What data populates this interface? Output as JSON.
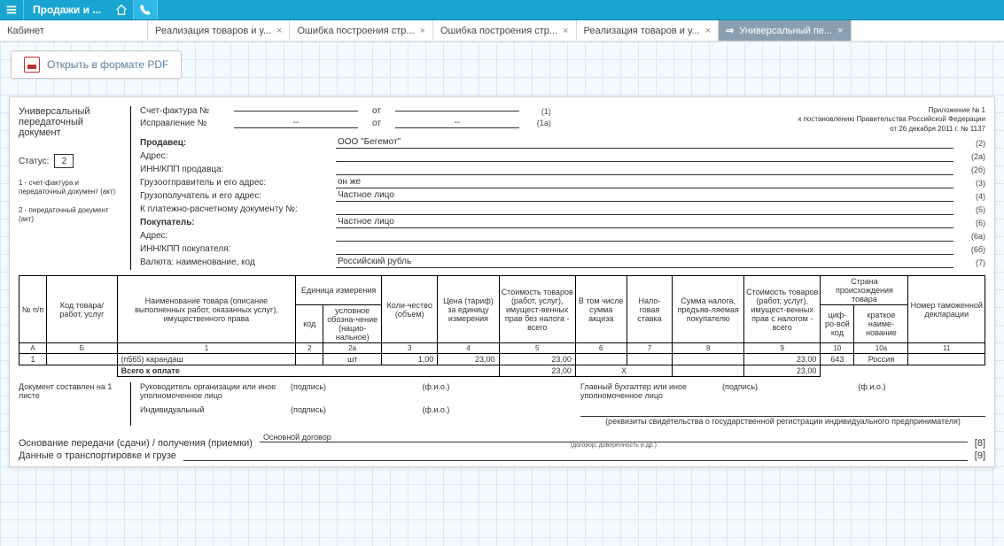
{
  "topbar": {
    "title": "Продажи и ..."
  },
  "tabs": [
    {
      "label": "Кабинет",
      "closable": false
    },
    {
      "label": "Реализация товаров и у...",
      "closable": true
    },
    {
      "label": "Ошибка построения стр...",
      "closable": true
    },
    {
      "label": "Ошибка построения стр...",
      "closable": true
    },
    {
      "label": "Реализация товаров и у...",
      "closable": true
    },
    {
      "label": "Универсальный пе...",
      "closable": true,
      "active": true,
      "prefix_arrow": true
    }
  ],
  "buttons": {
    "open_pdf": "Открыть в формате PDF"
  },
  "doc": {
    "left": {
      "title": "Универсальный передаточный документ",
      "status_label": "Статус:",
      "status_value": "2",
      "note1": "1 - счет-фактура и передаточный документ (акт)",
      "note2": "2 - передаточный документ (акт)"
    },
    "header_right": {
      "l1": "Приложение № 1",
      "l2": "к постановлению Правительства Российской Федерации",
      "l3": "от 26 декабря 2011 г. № 1137"
    },
    "invoice": {
      "invoice_label": "Счет-фактура №",
      "invoice_no": "",
      "invoice_from": "от",
      "invoice_date": "",
      "invoice_row_num": "(1)",
      "fix_label": "Исправление №",
      "fix_no": "--",
      "fix_date": "--",
      "fix_row_num": "(1а)"
    },
    "fields": [
      {
        "label": "Продавец:",
        "value": "ООО \"Бегемот\"",
        "num": "(2)",
        "bold": true
      },
      {
        "label": "Адрес:",
        "value": "",
        "num": "(2а)"
      },
      {
        "label": "ИНН/КПП продавца:",
        "value": "",
        "num": "(2б)"
      },
      {
        "label": "Грузоотправитель и его адрес:",
        "value": "он же",
        "num": "(3)"
      },
      {
        "label": "Грузополучатель и его адрес:",
        "value": "Частное лицо",
        "num": "(4)"
      },
      {
        "label": "К платежно-расчетному документу №:",
        "value": "",
        "num": "(5)"
      },
      {
        "label": "Покупатель:",
        "value": "Частное лицо",
        "num": "(6)",
        "bold": true
      },
      {
        "label": "Адрес:",
        "value": "",
        "num": "(6а)"
      },
      {
        "label": "ИНН/КПП покупателя:",
        "value": "",
        "num": "(6б)"
      },
      {
        "label": "Валюта: наименование, код",
        "value": "Российский рубль",
        "num": "(7)"
      }
    ],
    "table": {
      "headers": {
        "np": "№\nп/п",
        "code": "Код товара/\nработ, услуг",
        "name": "Наименование товара (описание выполненных работ, оказанных услуг), имущественного права",
        "unit": "Единица измерения",
        "unit_code": "код",
        "unit_name": "условное обозна-чение (нацио-нальное)",
        "qty": "Коли-чество (объем)",
        "price": "Цена (тариф) за единицу измерения",
        "cost_no_tax": "Стоимость товаров (работ, услуг), имущест-венных прав без налога - всего",
        "excise": "В том числе сумма акциза",
        "tax_rate": "Нало-говая ставка",
        "tax_sum": "Сумма налога, предъяв-ляемая покупателю",
        "cost_with_tax": "Стоимость товаров (работ, услуг), имущест-венных прав с налогом - всего",
        "country": "Страна происхождения товара",
        "country_code": "циф-ро-вой код",
        "country_name": "краткое наиме-нование",
        "decl": "Номер таможенной декларации"
      },
      "codes": {
        "a": "А",
        "b": "Б",
        "c1": "1",
        "c2": "2",
        "c2a": "2а",
        "c3": "3",
        "c4": "4",
        "c5": "5",
        "c6": "6",
        "c7": "7",
        "c8": "8",
        "c9": "9",
        "c10": "10",
        "c10a": "10а",
        "c11": "11"
      },
      "rows": [
        {
          "np": "1",
          "code": "",
          "name": "(п565) карандаш",
          "unit_code": "",
          "unit_name": "шт",
          "qty": "1,00",
          "price": "23,00",
          "cost_no_tax": "23,00",
          "excise": "",
          "tax_rate": "",
          "tax_sum": "",
          "cost_with_tax": "23,00",
          "country_code": "643",
          "country_name": "Россия",
          "decl": ""
        }
      ],
      "total": {
        "label": "Всего к оплате",
        "cost_no_tax": "23,00",
        "x": "Х",
        "cost_with_tax": "23,00"
      }
    },
    "footer": {
      "doc_compiled": "Документ составлен на 1 листе",
      "manager_label": "Руководитель организации или иное уполномоченное лицо",
      "accountant_label": "Главный бухгалтер или иное уполномоченное лицо",
      "individual_label": "Индивидуальный",
      "podpis": "(подпись)",
      "fio": "(ф.и.о.)",
      "requisites_note": "(реквизиты свидетельства о государственной регистрации индивидуального предпринимателя)",
      "basis_label": "Основание передачи (сдачи) / получения (приемки)",
      "basis_value": "Основной договор",
      "basis_sub": "(договор; доверенность и др.)",
      "basis_num": "[8]",
      "transport_label": "Данные о транспортировке и грузе",
      "transport_num": "[9]"
    }
  }
}
